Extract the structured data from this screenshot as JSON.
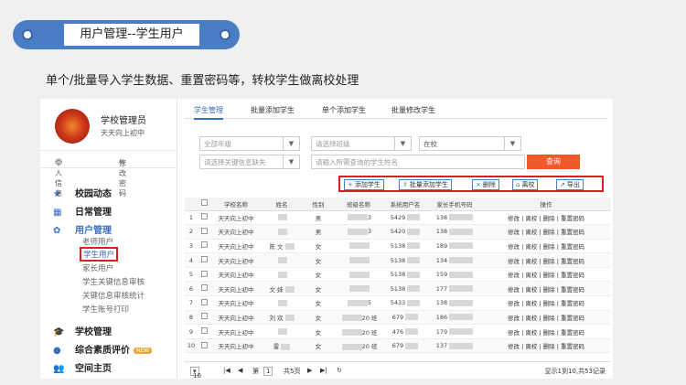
{
  "header": {
    "title": "用户管理--学生用户"
  },
  "subtitle": "单个/批量导入学生数据、重置密码等，转校学生做离校处理",
  "sidebar": {
    "user_name": "学校管理员",
    "school": "天天向上初中",
    "link_personal": "个人信息",
    "link_password": "修改密码",
    "groups": [
      {
        "label": "校园动态",
        "icon": "star-icon"
      },
      {
        "label": "日常管理",
        "icon": "grid-icon"
      },
      {
        "label": "用户管理",
        "icon": "gear-icon"
      },
      {
        "label": "学校管理",
        "icon": "graduation-cap-icon"
      },
      {
        "label": "综合素质评价",
        "icon": "chat-icon",
        "badge": "NEW"
      },
      {
        "label": "空间主页",
        "icon": "people-icon"
      }
    ],
    "user_sub": [
      "老师用户",
      "学生用户",
      "家长用户",
      "学生关键信息审核",
      "关键信息审核统计",
      "学生账号打印"
    ]
  },
  "tabs": [
    "学生管理",
    "批量添加学生",
    "单个添加学生",
    "批量修改学生"
  ],
  "filters": {
    "grade": "全部年级",
    "class": "请选择班级",
    "status": "在校",
    "key_info": "请选择关键信息缺失",
    "name_placeholder": "请输入所需查询的学生姓名",
    "query": "查询"
  },
  "toolbar": {
    "add": "添加学生",
    "batch_add": "批量添加学生",
    "delete": "删除",
    "leave": "离校",
    "export": "导出"
  },
  "table": {
    "headers": [
      "",
      "",
      "学校名称",
      "姓名",
      "性别",
      "班级名称",
      "系统用户名",
      "家长手机号码",
      "操作"
    ],
    "op_text": "修改 | 离校 | 删除 | 重置密码",
    "rows": [
      {
        "n": "1",
        "school": "天天向上初中",
        "name": "",
        "sex": "男",
        "cls": "3",
        "user": "5429",
        "phone": "138"
      },
      {
        "n": "2",
        "school": "天天向上初中",
        "name": "",
        "sex": "男",
        "cls": "3",
        "user": "5420",
        "phone": "138"
      },
      {
        "n": "3",
        "school": "天天向上初中",
        "name": "陈 文",
        "sex": "女",
        "cls": "",
        "user": "5138",
        "phone": "189"
      },
      {
        "n": "4",
        "school": "天天向上初中",
        "name": "",
        "sex": "女",
        "cls": "",
        "user": "5138",
        "phone": "134"
      },
      {
        "n": "5",
        "school": "天天向上初中",
        "name": "",
        "sex": "女",
        "cls": "",
        "user": "5138",
        "phone": "159"
      },
      {
        "n": "6",
        "school": "天天向上初中",
        "name": "文 妹",
        "sex": "女",
        "cls": "",
        "user": "5138",
        "phone": "177"
      },
      {
        "n": "7",
        "school": "天天向上初中",
        "name": "",
        "sex": "女",
        "cls": "5",
        "user": "5433",
        "phone": "138"
      },
      {
        "n": "8",
        "school": "天天向上初中",
        "name": "刘 欢",
        "sex": "女",
        "cls": "20 班",
        "user": "679",
        "phone": "186"
      },
      {
        "n": "9",
        "school": "天天向上初中",
        "name": "",
        "sex": "女",
        "cls": "20 班",
        "user": "476",
        "phone": "179"
      },
      {
        "n": "10",
        "school": "天天向上初中",
        "name": "雷",
        "sex": "女",
        "cls": "20 班",
        "user": "679",
        "phone": "137"
      }
    ]
  },
  "pager": {
    "page_size": "10",
    "page_label": "第",
    "page_num": "1",
    "page_total": "共5页",
    "summary": "显示1到10,共53记录"
  }
}
